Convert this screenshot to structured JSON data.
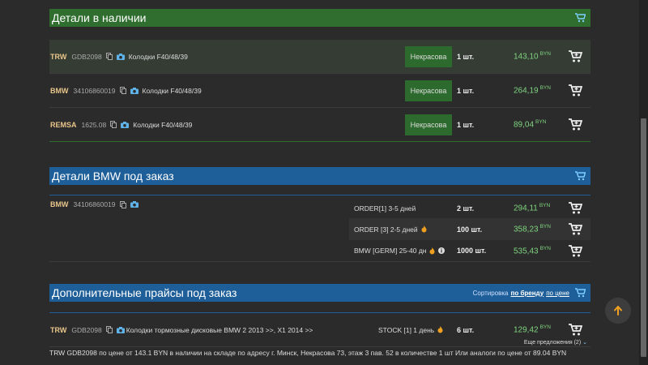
{
  "sections": {
    "instock": {
      "title": "Детали в наличии",
      "rows": [
        {
          "brand": "TRW",
          "code": "GDB2098",
          "desc": "Колодки F40/48/39",
          "store": "Некрасова",
          "qty": "1 шт.",
          "price": "143,10",
          "currency": "BYN"
        },
        {
          "brand": "BMW",
          "code": "34106860019",
          "desc": "Колодки F40/48/39",
          "store": "Некрасова",
          "qty": "1 шт.",
          "price": "264,19",
          "currency": "BYN"
        },
        {
          "brand": "REMSA",
          "code": "1625.08",
          "desc": "Колодки F40/48/39",
          "store": "Некрасова",
          "qty": "1 шт.",
          "price": "89,04",
          "currency": "BYN"
        }
      ]
    },
    "order": {
      "title": "Детали BMW под заказ",
      "brand": "BMW",
      "code": "34106860019",
      "offers": [
        {
          "option": "ORDER[1] 3-5 дней",
          "qty": "2 шт.",
          "price": "294,11",
          "currency": "BYN"
        },
        {
          "option": "ORDER [3] 2-5 дней",
          "qty": "100 шт.",
          "price": "358,23",
          "currency": "BYN"
        },
        {
          "option": "BMW [GERM] 25-40 дн",
          "qty": "1000 шт.",
          "price": "535,43",
          "currency": "BYN"
        }
      ]
    },
    "extra": {
      "title": "Дополнительные прайсы под заказ",
      "sort_label": "Сортировка",
      "sort_brand": "по бренду",
      "sort_price": "по цене",
      "row": {
        "brand": "TRW",
        "code": "GDB2098",
        "desc": "Колодки тормозные дисковые BMW 2 2013 >>, X1 2014 >>",
        "option": "STOCK [1] 1 день",
        "qty": "6 шт.",
        "price": "129,42",
        "currency": "BYN",
        "more": "Еще предложения (2)"
      }
    }
  },
  "footer": "TRW GDB2098 по цене от 143.1 BYN в наличии на складе по адресу г. Минск, Некрасова 73, этаж 3 пав. 52 в количестве 1 шт Или аналоги по цене от 89.04 BYN",
  "colors": {
    "green_header": "#2f6e2f",
    "blue_header": "#1f5f99",
    "price": "#7fd47f",
    "brand": "#e8c58a",
    "fire": "#f0a020"
  }
}
